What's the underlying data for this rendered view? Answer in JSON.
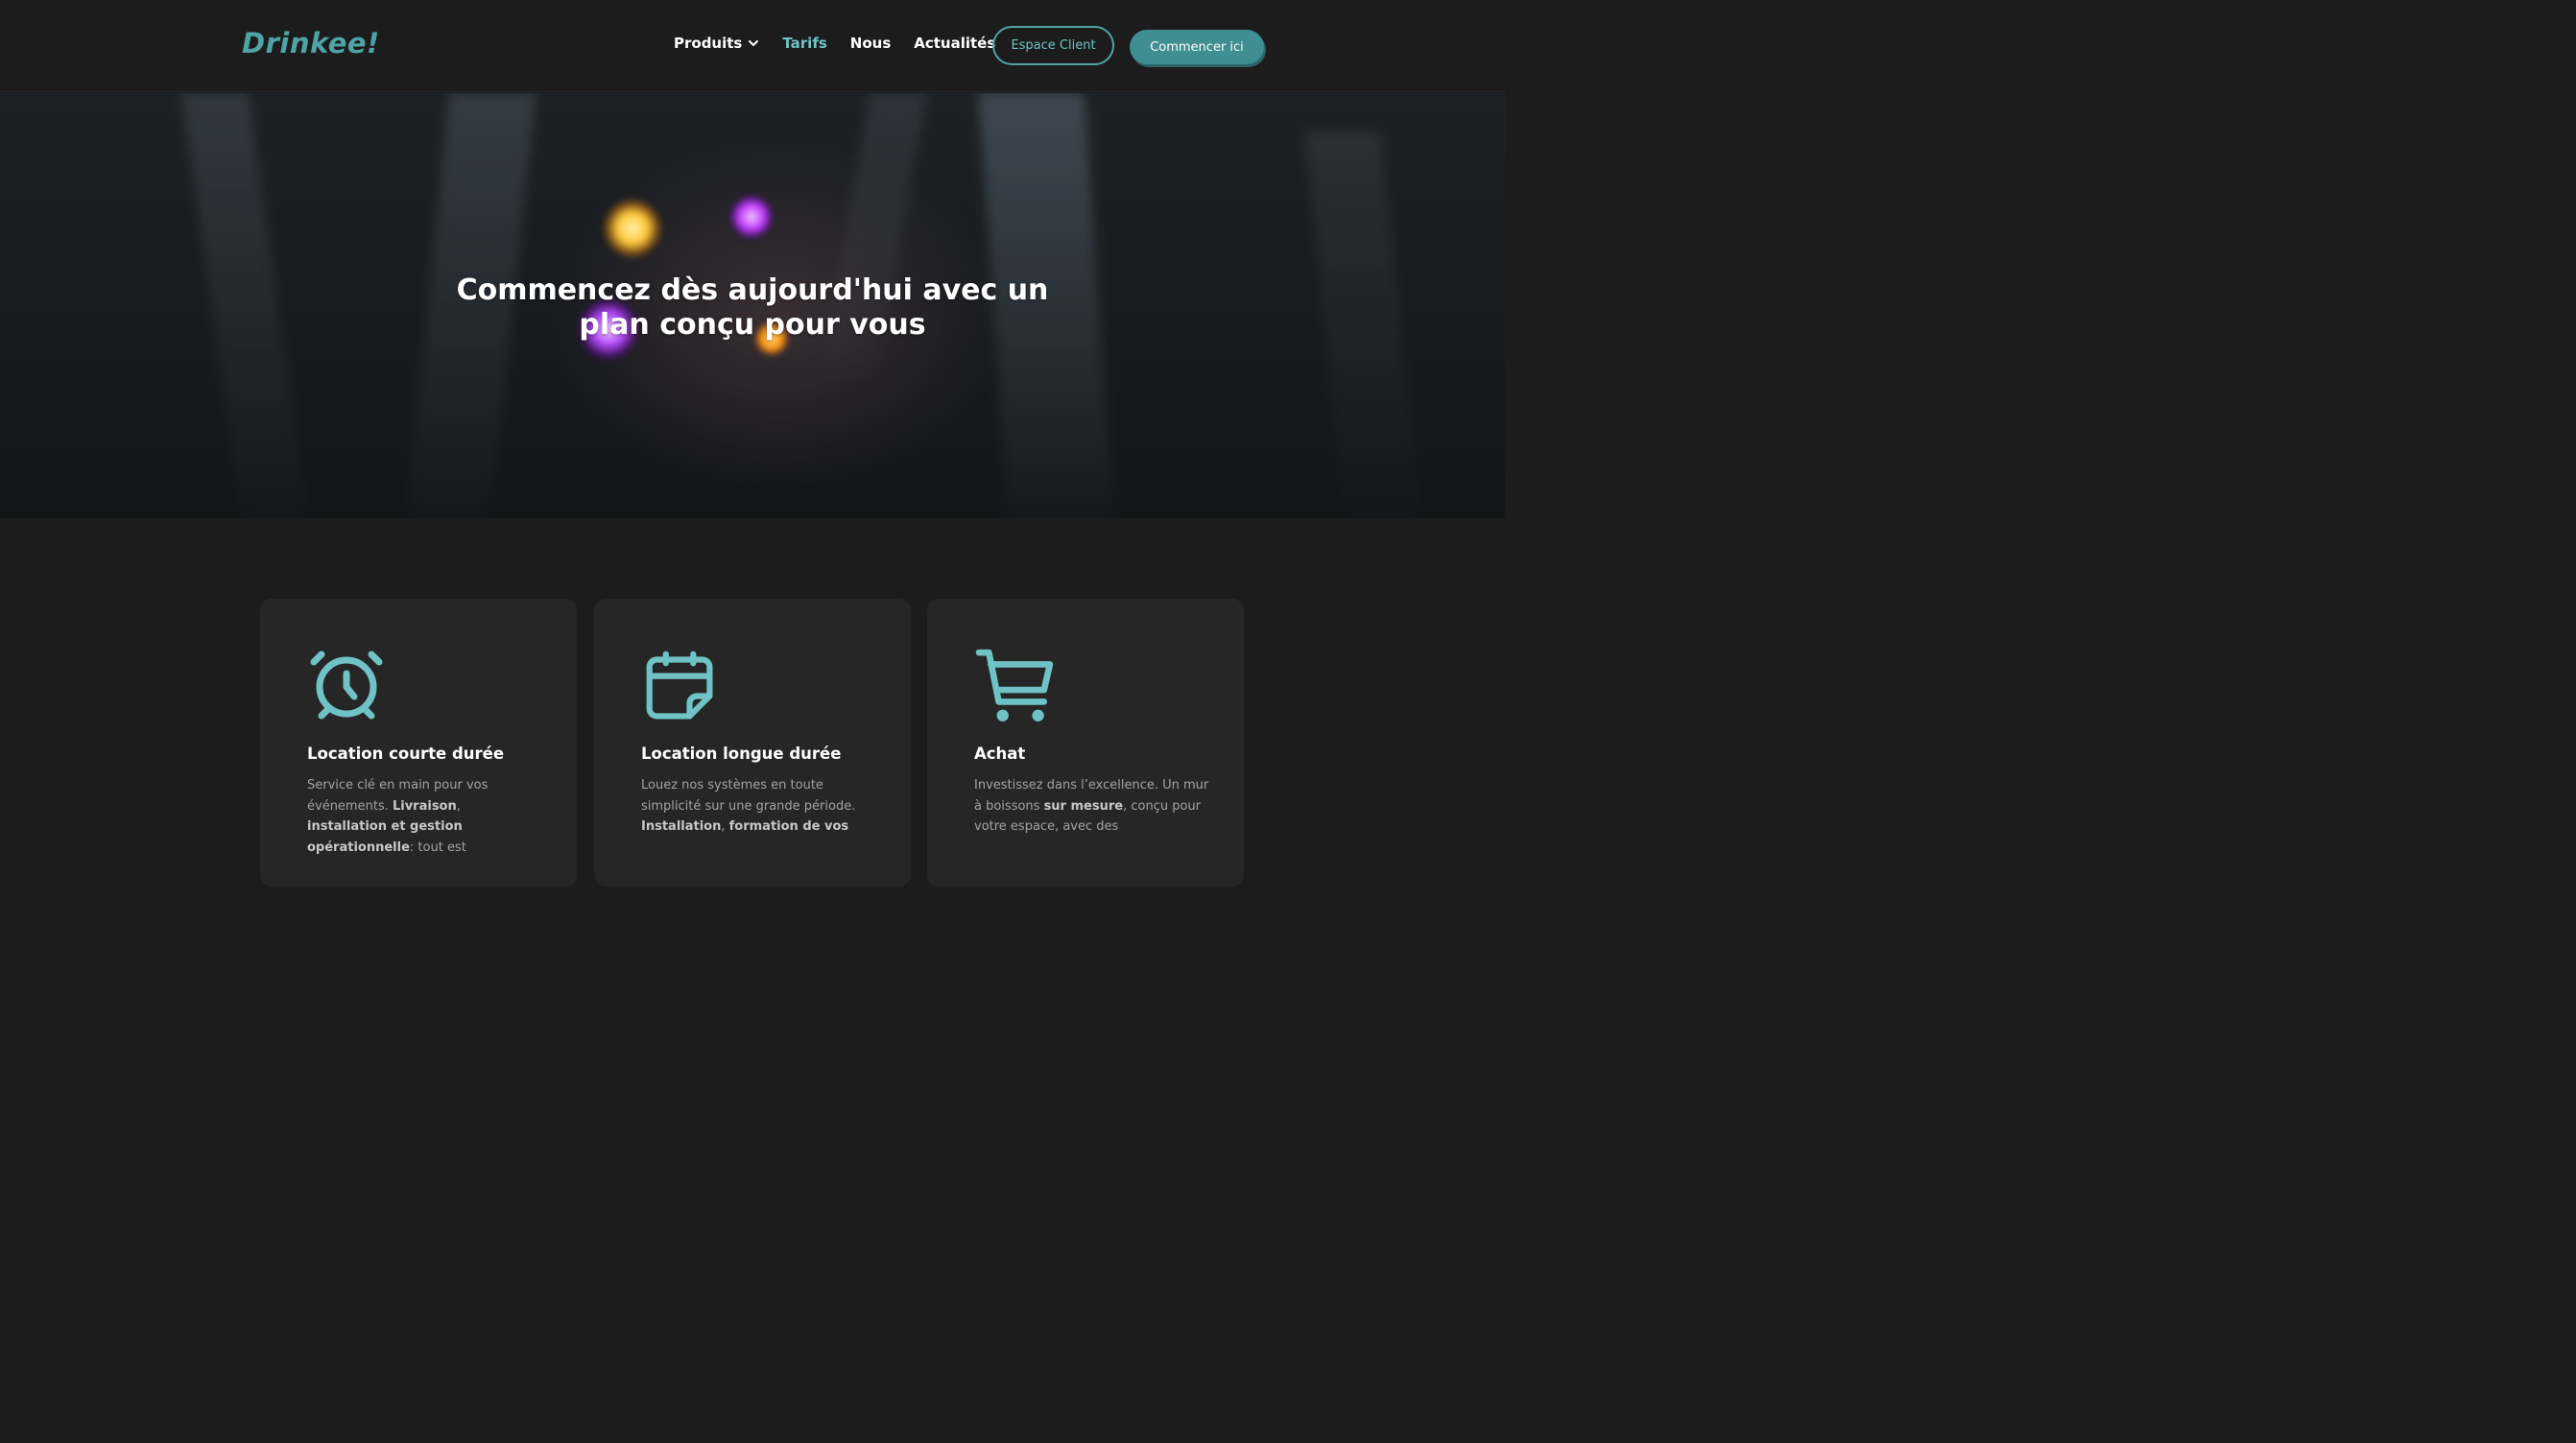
{
  "nav": {
    "logo": "Drinkee!",
    "links": [
      {
        "label": "Produits",
        "has_dropdown": true,
        "active": false
      },
      {
        "label": "Tarifs",
        "active": true
      },
      {
        "label": "Nous",
        "active": false
      },
      {
        "label": "Actualités",
        "active": false
      }
    ],
    "espace_client": "Espace Client",
    "commencer": "Commencer ici"
  },
  "hero": {
    "title_line1": "Commencez dès aujourd'hui avec un",
    "title_line2": "plan conçu pour vous"
  },
  "cards": [
    {
      "icon": "alarm-clock-icon",
      "title": "Location courte durée",
      "text": [
        {
          "t": "Service clé en main pour vos événements. "
        },
        {
          "t": "Livraison",
          "b": true
        },
        {
          "t": ", "
        },
        {
          "t": "installation et gestion opérationnelle",
          "b": true
        },
        {
          "t": ": tout est"
        }
      ]
    },
    {
      "icon": "calendar-icon",
      "title": "Location longue durée",
      "text": [
        {
          "t": "Louez nos systèmes en toute simplicité sur une grande période. "
        },
        {
          "t": "Installation",
          "b": true
        },
        {
          "t": ", "
        },
        {
          "t": "formation de vos",
          "b": true
        }
      ]
    },
    {
      "icon": "shopping-cart-icon",
      "title": "Achat",
      "text": [
        {
          "t": "Investissez dans l’excellence. Un mur à boissons "
        },
        {
          "t": "sur mesure",
          "b": true
        },
        {
          "t": ", conçu pour votre espace, avec des"
        }
      ]
    }
  ],
  "colors": {
    "accent": "#4fa3a5",
    "accent_light": "#6fc3c7",
    "background": "#1c1c1c",
    "card": "#262626"
  }
}
